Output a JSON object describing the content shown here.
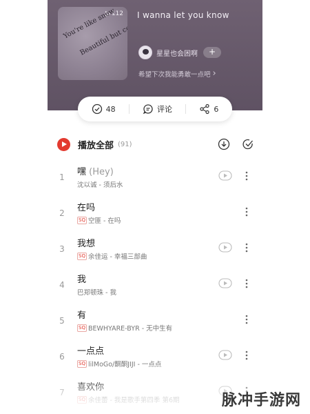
{
  "playlist": {
    "play_count": "112",
    "title": "I wanna let you know",
    "cover_lines": [
      "You're like snow",
      "Beautiful but cold"
    ],
    "creator": {
      "name": "星星也会困啊",
      "follow_label": "+"
    },
    "description": "希望下次我能勇敢一点吧",
    "description_arrow": "›"
  },
  "actions": {
    "collect_count": "48",
    "comment_label": "评论",
    "share_count": "6"
  },
  "play_all": {
    "label": "播放全部",
    "count": "(91)"
  },
  "songs": [
    {
      "index": "1",
      "title": "嘿",
      "alias": "(Hey)",
      "sq": false,
      "meta": "沈以诚 - 须后水",
      "mv": true
    },
    {
      "index": "2",
      "title": "在吗",
      "alias": "",
      "sq": true,
      "meta": "空匪 - 在吗",
      "mv": false
    },
    {
      "index": "3",
      "title": "我想",
      "alias": "",
      "sq": true,
      "meta": "余佳运 - 幸福三部曲",
      "mv": true
    },
    {
      "index": "4",
      "title": "我",
      "alias": "",
      "sq": false,
      "meta": "巴郑顿珠 - 我",
      "mv": true
    },
    {
      "index": "5",
      "title": "有",
      "alias": "",
      "sq": true,
      "meta": "BEWHYARE-BYR - 无中生有",
      "mv": false
    },
    {
      "index": "6",
      "title": "一点点",
      "alias": "",
      "sq": true,
      "meta": "lilMoGo/酮酮JIJI - 一点点",
      "mv": true
    },
    {
      "index": "7",
      "title": "喜欢你",
      "alias": "",
      "sq": true,
      "meta": "余佳蕾 - 我是歌手第四季 第6期",
      "mv": true
    }
  ],
  "sq_label": "SQ",
  "watermark": "脉冲手游网",
  "colors": {
    "header": "#6f6172",
    "accent": "#e33a2f"
  }
}
